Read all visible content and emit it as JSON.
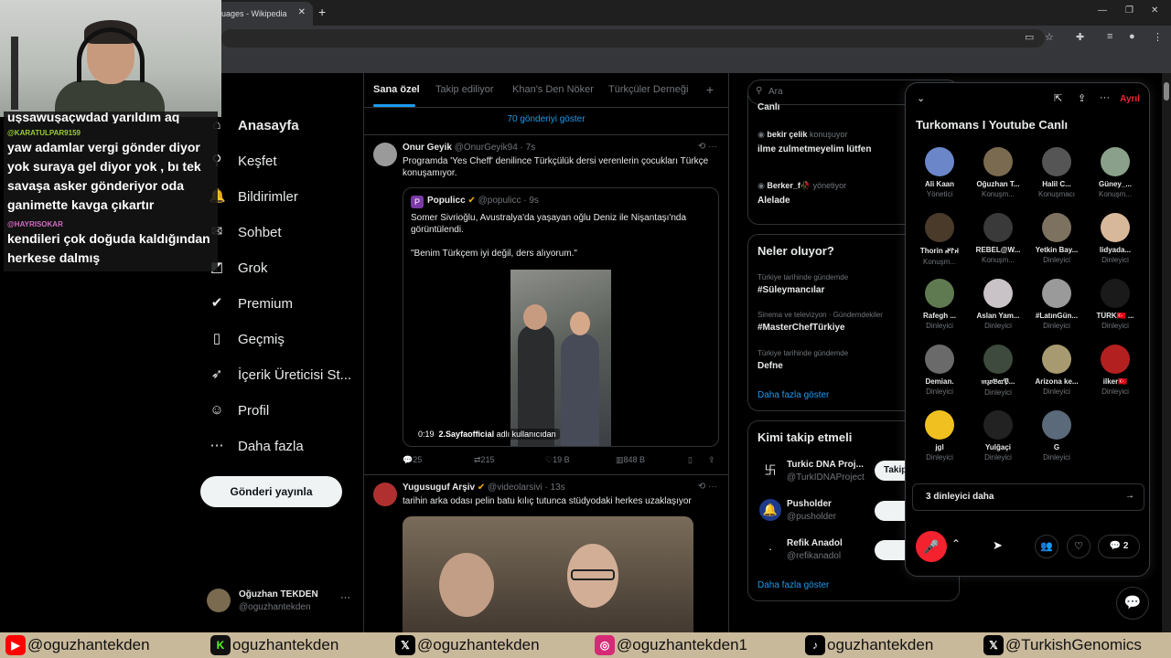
{
  "browser": {
    "tab_title": "uages - Wikipedia",
    "tab_close": "✕",
    "new_tab": "+",
    "min": "—",
    "max": "❐",
    "close": "✕"
  },
  "nav": {
    "items": [
      {
        "label": "Anasayfa",
        "icon": "⌂"
      },
      {
        "label": "Keşfet",
        "icon": "⚲"
      },
      {
        "label": "Bildirimler",
        "icon": "🔔"
      },
      {
        "label": "Sohbet",
        "icon": "✉"
      },
      {
        "label": "Grok",
        "icon": "◩"
      },
      {
        "label": "Premium",
        "icon": "✔"
      },
      {
        "label": "Geçmiş",
        "icon": "▯"
      },
      {
        "label": "İçerik Üreticisi St...",
        "icon": "➶"
      },
      {
        "label": "Profil",
        "icon": "☺"
      },
      {
        "label": "Daha fazla",
        "icon": "⋯"
      }
    ],
    "post_button": "Gönderi yayınla",
    "user": {
      "name": "Oğuzhan TEKDEN",
      "handle": "@oguzhantekden",
      "more": "···"
    }
  },
  "feed": {
    "tabs": [
      "Sana özel",
      "Takip ediliyor",
      "Khan's Den Nöker",
      "Türkçüler Derneği"
    ],
    "tab_add": "+",
    "show_more": "70 gönderiyi göster",
    "tweet1": {
      "name": "Onur Geyik",
      "handle": "@OnurGeyik94 · 7s",
      "text": "Programda 'Yes Cheff' denilince Türkçülük dersi verenlerin çocukları Türkçe konuşamıyor.",
      "quote": {
        "logo": "P",
        "name": "Populicc",
        "handle": "@populicc · 9s",
        "text": "Somer Sivrioğlu, Avustralya'da yaşayan oğlu Deniz ile Nişantaşı'nda görüntülendi.",
        "quote_line": "\"Benim Türkçem iyi değil, ders alıyorum.\"",
        "video_time": "0:19",
        "video_credit": "2.Sayfaofficial",
        "video_credit_suffix": "adlı kullanıcıdan"
      },
      "replies": "25",
      "reposts": "215",
      "likes": "19 B",
      "views": "848 B"
    },
    "tweet2": {
      "name": "Yugusuguf Arşiv",
      "handle": "@videolarsivi · 13s",
      "text": "tarihin arka odası pelin batu kılıç tutunca stüdyodaki herkes uzaklaşıyor"
    }
  },
  "right": {
    "search_placeholder": "Ara",
    "space_rows": [
      {
        "user": "bekir çelik",
        "role": "konuşuyor",
        "title": "ilme zulmetmeyelim lütfen"
      },
      {
        "user": "Berker_f🥀",
        "role": "yönetiyor",
        "title": "Alelade"
      }
    ],
    "space_top_title": "Canlı",
    "trends_title": "Neler oluyor?",
    "trends": [
      {
        "context": "Türkiye tarihinde gündemde",
        "name": "#Süleymancılar"
      },
      {
        "context": "Sinema ve televizyon · Gündemdekiler",
        "name": "#MasterChefTürkiye"
      },
      {
        "context": "Türkiye tarihinde gündemde",
        "name": "Defne"
      }
    ],
    "trends_more": "Daha fazla göster",
    "follow_title": "Kimi takip etmeli",
    "follow": [
      {
        "name": "Turkic DNA Proj...",
        "handle": "@TurkIDNAProject",
        "button": "Takip"
      },
      {
        "name": "Pusholder",
        "handle": "@pusholder",
        "button": ""
      },
      {
        "name": "Refik Anadol",
        "handle": "@refikanadol",
        "button": ""
      }
    ],
    "follow_more": "Daha fazla göster"
  },
  "space": {
    "title": "Turkomans I Youtube Canlı",
    "leave": "Ayrıl",
    "listeners": [
      {
        "name": "Ali Kaan",
        "role": "Yönetici",
        "color": "#6b86c9"
      },
      {
        "name": "Oğuzhan T...",
        "role": "Konuşm...",
        "color": "#7a6a50"
      },
      {
        "name": "Halil C...",
        "role": "Konuşmacı",
        "color": "#555555"
      },
      {
        "name": "Güney_...",
        "role": "Konuşm...",
        "color": "#8aa08a"
      },
      {
        "name": "Thorin 𐰴𐰃𐰤",
        "role": "Konuşm...",
        "color": "#4a3a2a"
      },
      {
        "name": "REBEL@W...",
        "role": "Konuşm...",
        "color": "#3a3a3a"
      },
      {
        "name": "Yetkin Bay...",
        "role": "Dinleyici",
        "color": "#7d7260"
      },
      {
        "name": "lidyada...",
        "role": "Dinleyici",
        "color": "#d8b89a"
      },
      {
        "name": "Rafegh ...",
        "role": "Dinleyici",
        "color": "#5f7a50"
      },
      {
        "name": "Aslan Yam...",
        "role": "Dinleyici",
        "color": "#c9c2c6"
      },
      {
        "name": "#LatınGün...",
        "role": "Dinleyici",
        "color": "#9a9a9a"
      },
      {
        "name": "TÜRK🇹🇷 ...",
        "role": "Dinleyici",
        "color": "#1a1a1a"
      },
      {
        "name": "Demian.",
        "role": "Dinleyici",
        "color": "#6a6a6a"
      },
      {
        "name": "𝔪𝔷𝔬𝔅𝔞𝔯𝔓...",
        "role": "Dinleyici",
        "color": "#3d4a3d"
      },
      {
        "name": "Arizona ke...",
        "role": "Dinleyici",
        "color": "#a89a70"
      },
      {
        "name": "ilker🇹🇷",
        "role": "Dinleyici",
        "color": "#b32020"
      },
      {
        "name": "jgl",
        "role": "Dinleyici",
        "color": "#f0c020"
      },
      {
        "name": "Yulğaçi",
        "role": "Dinleyici",
        "color": "#222222"
      },
      {
        "name": "G",
        "role": "Dinleyici",
        "color": "#5a6a7a"
      }
    ],
    "more_listeners": "3 dinleyici daha",
    "chat_count": "2"
  },
  "stream_chat": {
    "lines": [
      {
        "user": "",
        "text": "uşsawuşaçwdad yarıldım aq"
      },
      {
        "user": "@KARATULPAR9159",
        "text": "yaw adamlar vergi gönder diyor yok suraya gel diyor yok , bı tek savaşa asker gönderiyor oda ganimette kavga çıkartır"
      },
      {
        "user": "@HAYRISOKAR",
        "text": "kendileri çok doğuda kaldığından herkese dalmış"
      }
    ]
  },
  "socials": [
    {
      "icon": "▶",
      "color": "#ff0000",
      "text": "@oguzhantekden"
    },
    {
      "icon": "K",
      "color": "#53fc18",
      "text": "oguzhantekden"
    },
    {
      "icon": "𝕏",
      "color": "#000000",
      "text": "@oguzhantekden"
    },
    {
      "icon": "◎",
      "color": "#d62976",
      "text": "@oguzhantekden1"
    },
    {
      "icon": "♪",
      "color": "#000000",
      "text": "oguzhantekden"
    },
    {
      "icon": "𝕏",
      "color": "#000000",
      "text": "@TurkishGenomics"
    }
  ],
  "colors": {
    "accent": "#1d9bf0",
    "danger": "#f4212e",
    "socials_bg": "#c9b99b"
  }
}
